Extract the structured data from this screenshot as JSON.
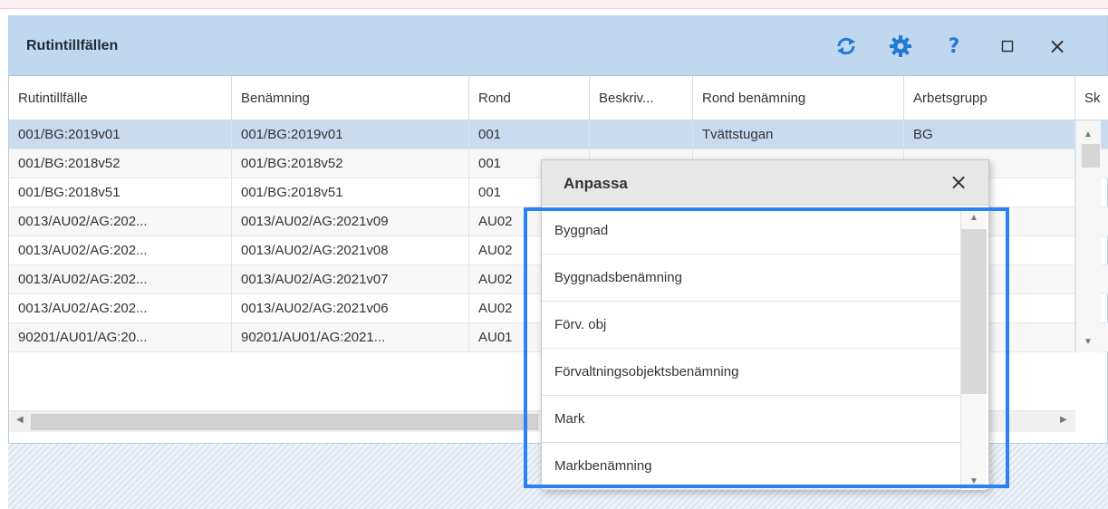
{
  "window": {
    "title": "Rutintillfällen"
  },
  "toolbar": {
    "refresh_icon": "refresh-icon",
    "settings_icon": "gear-icon",
    "help_label": "?",
    "maximize_icon": "maximize-icon",
    "close_label": "×"
  },
  "grid": {
    "columns": [
      "Rutintillfälle",
      "Benämning",
      "Rond",
      "Beskriv...",
      "Rond benämning",
      "Arbetsgrupp",
      "Sk"
    ],
    "rows": [
      [
        "001/BG:2019v01",
        "001/BG:2019v01",
        "001",
        "",
        "Tvättstugan",
        "BG"
      ],
      [
        "001/BG:2018v52",
        "001/BG:2018v52",
        "001",
        "",
        "",
        ""
      ],
      [
        "001/BG:2018v51",
        "001/BG:2018v51",
        "001",
        "",
        "",
        ""
      ],
      [
        "0013/AU02/AG:202...",
        "0013/AU02/AG:2021v09",
        "AU02",
        "",
        "",
        ""
      ],
      [
        "0013/AU02/AG:202...",
        "0013/AU02/AG:2021v08",
        "AU02",
        "",
        "",
        ""
      ],
      [
        "0013/AU02/AG:202...",
        "0013/AU02/AG:2021v07",
        "AU02",
        "",
        "",
        ""
      ],
      [
        "0013/AU02/AG:202...",
        "0013/AU02/AG:2021v06",
        "AU02",
        "",
        "",
        ""
      ],
      [
        "90201/AU01/AG:20...",
        "90201/AU01/AG:2021...",
        "AU01",
        "",
        "",
        ""
      ]
    ]
  },
  "popup": {
    "title": "Anpassa",
    "close_label": "×",
    "items": [
      "Byggnad",
      "Byggnadsbenämning",
      "Förv. obj",
      "Förvaltningsobjektsbenämning",
      "Mark",
      "Markbenämning"
    ]
  },
  "colors": {
    "header_bg": "#c0d8ef",
    "selected_row": "#c8dbef",
    "focus_ring": "#2a82f5",
    "icon_blue": "#1f7ad6"
  }
}
